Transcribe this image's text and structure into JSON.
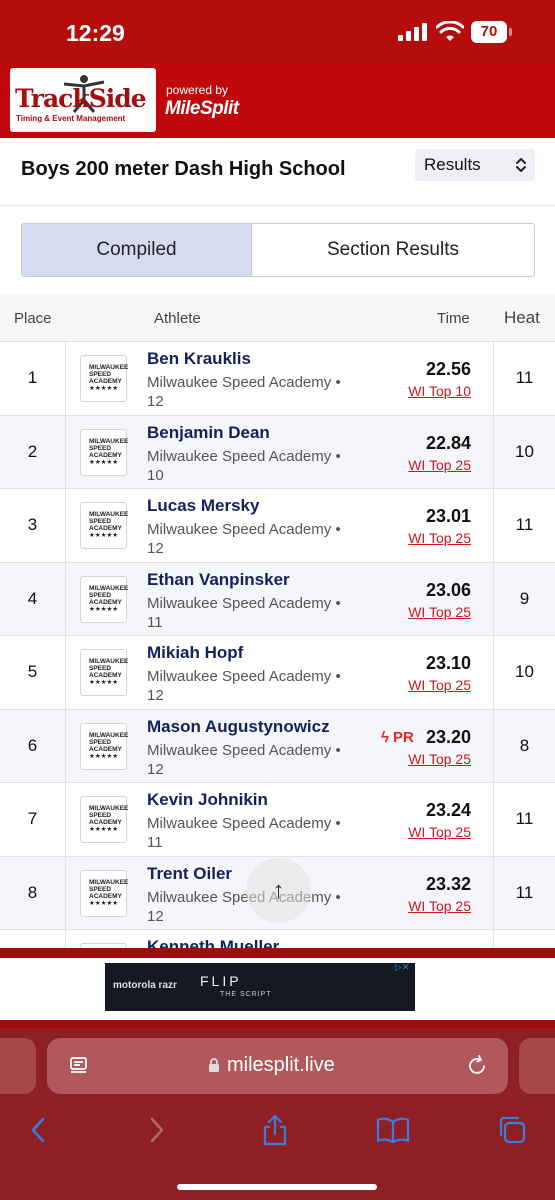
{
  "status": {
    "time": "12:29",
    "battery": "70"
  },
  "brand": {
    "logo_word": "TrackSide",
    "logo_sub": "Timing & Event Management",
    "powered_by": "powered by",
    "partner": "MileSplit"
  },
  "event": {
    "title": "Boys 200 meter Dash High School",
    "view_selected": "Results"
  },
  "tabs": [
    {
      "label": "Compiled",
      "active": true
    },
    {
      "label": "Section Results",
      "active": false
    }
  ],
  "columns": {
    "place": "Place",
    "athlete": "Athlete",
    "time": "Time",
    "heat": "Heat"
  },
  "team_logo_text": [
    "MILWAUKEE",
    "SPEED",
    "ACADEMY",
    "★★★★★"
  ],
  "rows": [
    {
      "place": "1",
      "name": "Ben Krauklis",
      "team": "Milwaukee Speed Academy • 12",
      "time": "22.56",
      "rank": "WI Top 10",
      "pr": "",
      "heat": "11"
    },
    {
      "place": "2",
      "name": "Benjamin Dean",
      "team": "Milwaukee Speed Academy • 10",
      "time": "22.84",
      "rank": "WI Top 25",
      "pr": "",
      "heat": "10"
    },
    {
      "place": "3",
      "name": "Lucas Mersky",
      "team": "Milwaukee Speed Academy • 12",
      "time": "23.01",
      "rank": "WI Top 25",
      "pr": "",
      "heat": "11"
    },
    {
      "place": "4",
      "name": "Ethan Vanpinsker",
      "team": "Milwaukee Speed Academy • 11",
      "time": "23.06",
      "rank": "WI Top 25",
      "pr": "",
      "heat": "9"
    },
    {
      "place": "5",
      "name": "Mikiah Hopf",
      "team": "Milwaukee Speed Academy • 12",
      "time": "23.10",
      "rank": "WI Top 25",
      "pr": "",
      "heat": "10"
    },
    {
      "place": "6",
      "name": "Mason Augustynowicz",
      "team": "Milwaukee Speed Academy • 12",
      "time": "23.20",
      "rank": "WI Top 25",
      "pr": "PR",
      "heat": "8"
    },
    {
      "place": "7",
      "name": "Kevin Johnikin",
      "team": "Milwaukee Speed Academy • 11",
      "time": "23.24",
      "rank": "WI Top 25",
      "pr": "",
      "heat": "11"
    },
    {
      "place": "8",
      "name": "Trent Oiler",
      "team": "Milwaukee Speed Academy • 12",
      "time": "23.32",
      "rank": "WI Top 25",
      "pr": "",
      "heat": "11"
    },
    {
      "place": "",
      "name": "Kenneth Mueller",
      "team": "",
      "time": "",
      "rank": "",
      "pr": "",
      "heat": ""
    }
  ],
  "ad": {
    "brand": "motorola razr",
    "headline": "FLIP",
    "subline": "THE SCRIPT"
  },
  "browser": {
    "host": "milesplit.live"
  },
  "colors": {
    "brand_red": "#c0080c",
    "status_red": "#b40d0d",
    "name_navy": "#14215c",
    "rank_red": "#d3161f",
    "toolbar_blue": "#3b7ddd"
  }
}
